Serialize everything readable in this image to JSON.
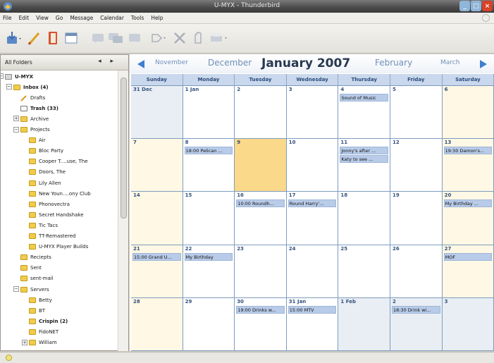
{
  "window": {
    "title": "U-MYX - Thunderbird"
  },
  "menu": [
    "File",
    "Edit",
    "View",
    "Go",
    "Message",
    "Calendar",
    "Tools",
    "Help"
  ],
  "toolbar": {
    "icons": [
      "get-mail-icon",
      "write-icon",
      "address-book-icon",
      "calendar-icon",
      "reply-icon",
      "reply-all-icon",
      "forward-icon",
      "tag-icon",
      "delete-icon",
      "junk-icon",
      "print-icon"
    ]
  },
  "folder_pane": {
    "header": "All Folders",
    "items": [
      {
        "label": "U-MYX",
        "bold": true,
        "type": "server"
      },
      {
        "label": "Inbox (4)",
        "bold": true,
        "type": "folder"
      },
      {
        "label": "Drafts",
        "bold": false,
        "type": "draft"
      },
      {
        "label": "Trash (33)",
        "bold": true,
        "type": "trash"
      },
      {
        "label": "Archive",
        "bold": false,
        "type": "folder"
      },
      {
        "label": "Projects",
        "bold": false,
        "type": "folder"
      },
      {
        "label": "Air",
        "bold": false,
        "type": "folder"
      },
      {
        "label": "Bloc Party",
        "bold": false,
        "type": "folder"
      },
      {
        "label": "Cooper T....use, The",
        "bold": false,
        "type": "folder"
      },
      {
        "label": "Doors, The",
        "bold": false,
        "type": "folder"
      },
      {
        "label": "Lily Allen",
        "bold": false,
        "type": "folder"
      },
      {
        "label": "New Youn....ony Club",
        "bold": false,
        "type": "folder"
      },
      {
        "label": "Phonovectra",
        "bold": false,
        "type": "folder"
      },
      {
        "label": "Secret Handshake",
        "bold": false,
        "type": "folder"
      },
      {
        "label": "Tic Tacs",
        "bold": false,
        "type": "folder"
      },
      {
        "label": "TT-Remastered",
        "bold": false,
        "type": "folder"
      },
      {
        "label": "U-MYX Player Builds",
        "bold": false,
        "type": "folder"
      },
      {
        "label": "Reciepts",
        "bold": false,
        "type": "folder"
      },
      {
        "label": "Sent",
        "bold": false,
        "type": "folder"
      },
      {
        "label": "sent-mail",
        "bold": false,
        "type": "folder"
      },
      {
        "label": "Servers",
        "bold": false,
        "type": "folder"
      },
      {
        "label": "Betty",
        "bold": false,
        "type": "folder"
      },
      {
        "label": "BT",
        "bold": false,
        "type": "folder"
      },
      {
        "label": "Crispin (2)",
        "bold": true,
        "type": "folder"
      },
      {
        "label": "FidoNET",
        "bold": false,
        "type": "folder"
      },
      {
        "label": "William",
        "bold": false,
        "type": "folder"
      }
    ]
  },
  "calendar": {
    "nav": {
      "prev2": "November",
      "prev1": "December",
      "current": "January 2007",
      "next1": "February",
      "next2": "March"
    },
    "days": [
      "Sunday",
      "Monday",
      "Tuesday",
      "Wednesday",
      "Thursday",
      "Friday",
      "Saturday"
    ],
    "weeks": [
      [
        {
          "d": "31 Dec",
          "other": true,
          "ev": []
        },
        {
          "d": "1 Jan",
          "ev": []
        },
        {
          "d": "2",
          "ev": []
        },
        {
          "d": "3",
          "ev": []
        },
        {
          "d": "4",
          "ev": [
            "Sound of Music"
          ]
        },
        {
          "d": "5",
          "ev": []
        },
        {
          "d": "6",
          "ev": []
        }
      ],
      [
        {
          "d": "7",
          "ev": []
        },
        {
          "d": "8",
          "ev": [
            "18:00 Pelican ..."
          ]
        },
        {
          "d": "9",
          "today": true,
          "ev": []
        },
        {
          "d": "10",
          "ev": []
        },
        {
          "d": "11",
          "ev": [
            "Jonny's after ...",
            "Katy to see ..."
          ]
        },
        {
          "d": "12",
          "ev": []
        },
        {
          "d": "13",
          "ev": [
            "19:30 Damon's..."
          ]
        }
      ],
      [
        {
          "d": "14",
          "ev": []
        },
        {
          "d": "15",
          "ev": []
        },
        {
          "d": "16",
          "ev": [
            "10:00 Roundh..."
          ]
        },
        {
          "d": "17",
          "ev": [
            "Round Harry'..."
          ]
        },
        {
          "d": "18",
          "ev": []
        },
        {
          "d": "19",
          "ev": []
        },
        {
          "d": "20",
          "ev": [
            "My Birthday ..."
          ]
        }
      ],
      [
        {
          "d": "21",
          "ev": [
            "15:00 Grand U..."
          ]
        },
        {
          "d": "22",
          "ev": [
            "My Birthday"
          ]
        },
        {
          "d": "23",
          "ev": []
        },
        {
          "d": "24",
          "ev": []
        },
        {
          "d": "25",
          "ev": []
        },
        {
          "d": "26",
          "ev": []
        },
        {
          "d": "27",
          "ev": [
            "MOF"
          ]
        }
      ],
      [
        {
          "d": "28",
          "ev": []
        },
        {
          "d": "29",
          "ev": []
        },
        {
          "d": "30",
          "ev": [
            "19:00 Drinks w..."
          ]
        },
        {
          "d": "31 Jan",
          "ev": [
            "15:00 MTV"
          ]
        },
        {
          "d": "1 Feb",
          "other": true,
          "ev": []
        },
        {
          "d": "2",
          "other": true,
          "ev": [
            "18:30 Drink wi..."
          ]
        },
        {
          "d": "3",
          "other": true,
          "ev": []
        }
      ]
    ]
  }
}
